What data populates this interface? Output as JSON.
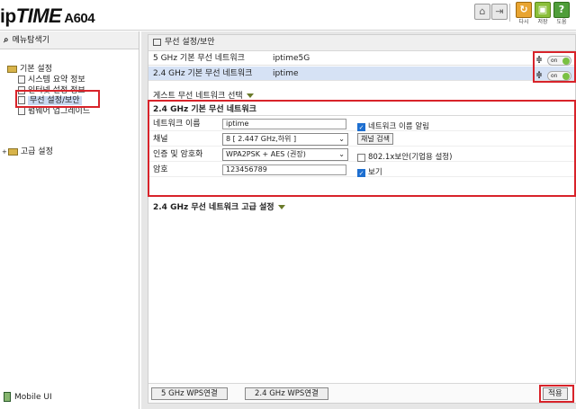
{
  "header": {
    "logo_ip": "ip",
    "logo_time": "TIME",
    "logo_model": "A604",
    "buttons": [
      {
        "name": "home-icon",
        "label": ""
      },
      {
        "name": "logout-icon",
        "label": ""
      },
      {
        "name": "refresh-icon",
        "label": "다시"
      },
      {
        "name": "save-icon",
        "label": "저장"
      },
      {
        "name": "help-icon",
        "label": "도움"
      }
    ],
    "colors": {
      "refresh": "#e8a431",
      "save": "#8bbf3a",
      "help": "#4f9e3a"
    }
  },
  "sidebar": {
    "title": "메뉴탐색기",
    "group_basic": "기본 설정",
    "items": [
      {
        "label": "시스템 요약 정보"
      },
      {
        "label": "인터넷 설정 정보"
      },
      {
        "label": "무선 설정/보안"
      },
      {
        "label": "펌웨어 업그레이드"
      }
    ],
    "group_advanced": "고급 설정",
    "mobile": "Mobile UI"
  },
  "main": {
    "title": "무선 설정/보안",
    "networks": [
      {
        "band": "5 GHz 기본 무선 네트워크",
        "ssid": "iptime5G",
        "toggle": "on"
      },
      {
        "band": "2.4 GHz 기본 무선 네트워크",
        "ssid": "iptime",
        "toggle": "on"
      }
    ],
    "guest": "게스트 무선 네트워크 선택",
    "section_title": "2.4 GHz 기본 무선 네트워크",
    "form": {
      "name_label": "네트워크 이름",
      "name_value": "iptime",
      "hide_label": "네트워크 이름 알림",
      "channel_label": "채널",
      "channel_value": "8 [ 2.447 GHz,하위 ]",
      "channel_search": "채널 검색",
      "auth_label": "인증 및 암호화",
      "auth_value": "WPA2PSK + AES (권장)",
      "enterprise_label": "802.1x보안(기업용 설정)",
      "pw_label": "암호",
      "pw_value": "123456789",
      "show_label": "보기"
    },
    "advanced": "2.4 GHz 무선 네트워크 고급 설정",
    "wps5": "5 GHz WPS연결",
    "wps24": "2.4 GHz WPS연결",
    "apply": "적용"
  }
}
